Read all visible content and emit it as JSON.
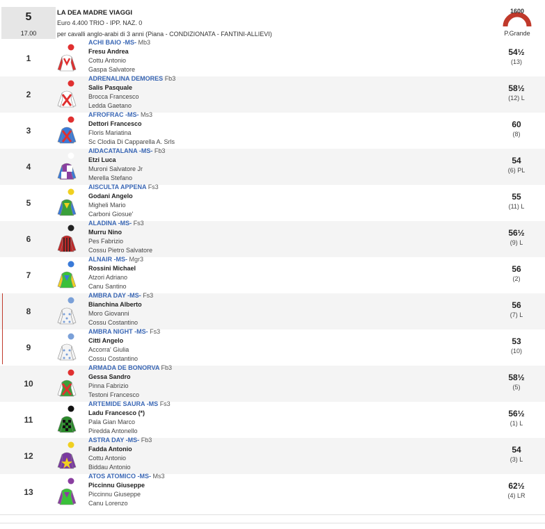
{
  "race": {
    "number": "5",
    "time": "17.00",
    "title": "LA DEA MADRE VIAGGI",
    "prize": "Euro 4.400 TRIO - IPP. NAZ. 0",
    "conditions": "per cavalli anglo-arabi di 3 anni (Piana -  CONDIZIONATA  - FANTINI-ALLIEVI)",
    "distance": "1600",
    "track": "P.Grande"
  },
  "runners": [
    {
      "num": "1",
      "name": "ACHI BAIO -MS-",
      "form": "Mb3",
      "jockey": "Fresu Andrea",
      "trainer": "Cottu Antonio",
      "owner": "Gaspa Salvatore",
      "weight": "54½",
      "detail": "(13)",
      "silk": "red-white-hoops"
    },
    {
      "num": "2",
      "name": "ADRENALINA DEMORES",
      "form": "Fb3",
      "jockey": "Salis Pasquale",
      "trainer": "Brocca Francesco",
      "owner": "Ledda Gaetano",
      "weight": "58½",
      "detail": "(12) L",
      "silk": "white-red-cross"
    },
    {
      "num": "3",
      "name": "AFROFRAC -MS-",
      "form": "Ms3",
      "jockey": "Dettori Francesco",
      "trainer": "Floris Mariatina",
      "owner": "Sc Clodia Di Capparella A. Srls",
      "weight": "60",
      "detail": "(8)",
      "silk": "blue-red-cross"
    },
    {
      "num": "4",
      "name": "AIDACATALANA -MS-",
      "form": "Fb3",
      "jockey": "Etzi Luca",
      "trainer": "Muroni Salvatore Jr",
      "owner": "Merella Stefano",
      "weight": "54",
      "detail": "(6) PL",
      "silk": "purple-white-quarters"
    },
    {
      "num": "5",
      "name": "AISCULTA APPENA",
      "form": "Fs3",
      "jockey": "Godani Angelo",
      "trainer": "Migheli Mario",
      "owner": "Carboni Giosue'",
      "weight": "55",
      "detail": "(11) L",
      "silk": "green-yellow-blue"
    },
    {
      "num": "6",
      "name": "ALADINA -MS-",
      "form": "Fs3",
      "jockey": "Murru Nino",
      "trainer": "Pes Fabrizio",
      "owner": "Cossu Pietro Salvatore",
      "weight": "56½",
      "detail": "(9) L",
      "silk": "red-black-stripes"
    },
    {
      "num": "7",
      "name": "ALNAIR -MS-",
      "form": "Mgr3",
      "jockey": "Rossini Michael",
      "trainer": "Atzori Adriano",
      "owner": "Canu Santino",
      "weight": "56",
      "detail": "(2)",
      "silk": "green-blue-yellow"
    },
    {
      "num": "8",
      "name": "AMBRA DAY -MS-",
      "form": "Fs3",
      "jockey": "Bianchina Alberto",
      "trainer": "Moro Giovanni",
      "owner": "Cossu Costantino",
      "weight": "56",
      "detail": "(7) L",
      "silk": "white-blue-spots"
    },
    {
      "num": "9",
      "name": "AMBRA NIGHT -MS-",
      "form": "Fs3",
      "jockey": "Citti Angelo",
      "trainer": "Accorra' Giulia",
      "owner": "Cossu Costantino",
      "weight": "53",
      "detail": "(10)",
      "silk": "white-blue-spots"
    },
    {
      "num": "10",
      "name": "ARMADA DE BONORVA",
      "form": "Fb3",
      "jockey": "Gessa Sandro",
      "trainer": "Pinna Fabrizio",
      "owner": "Testoni Francesco",
      "weight": "58½",
      "detail": "(5)",
      "silk": "green-red-cross"
    },
    {
      "num": "11",
      "name": "ARTEMIDE SAURA -MS",
      "form": "Fs3",
      "jockey": "Ladu Francesco (*)",
      "trainer": "Pala Gian Marco",
      "owner": "Piredda Antonello",
      "weight": "56½",
      "detail": "(1) L",
      "silk": "green-black-check"
    },
    {
      "num": "12",
      "name": "ASTRA DAY -MS-",
      "form": "Fb3",
      "jockey": "Fadda Antonio",
      "trainer": "Cottu Antonio",
      "owner": "Biddau Antonio",
      "weight": "54",
      "detail": "(3) L",
      "silk": "purple-yellow-star"
    },
    {
      "num": "13",
      "name": "ATOS ATOMICO -MS-",
      "form": "Ms3",
      "jockey": "Piccinnu Giuseppe",
      "trainer": "Piccinnu Giuseppe",
      "owner": "Canu Lorenzo",
      "weight": "62½",
      "detail": "(4) LR",
      "silk": "green-purple"
    }
  ]
}
